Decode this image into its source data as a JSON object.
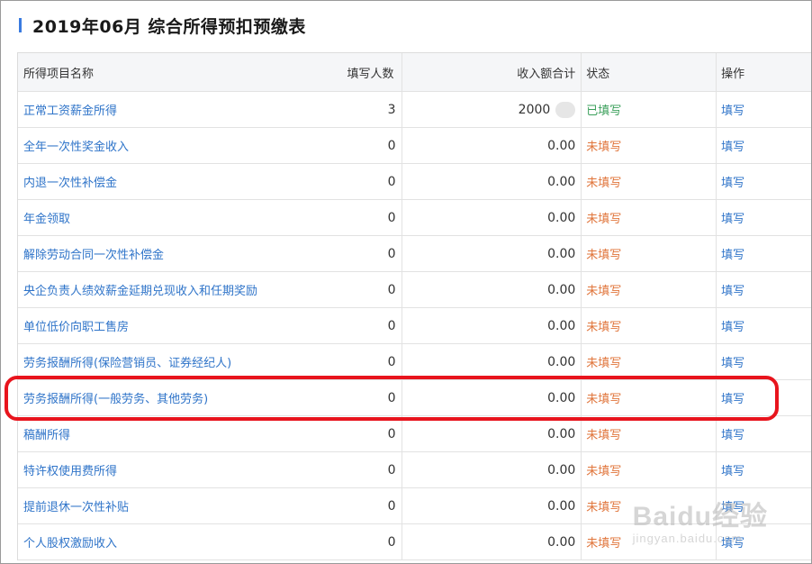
{
  "page": {
    "title": "2019年06月  综合所得预扣预缴表"
  },
  "table": {
    "headers": {
      "name": "所得项目名称",
      "count": "填写人数",
      "amount": "收入额合计",
      "status": "状态",
      "operation": "操作"
    },
    "rows": [
      {
        "name": "正常工资薪金所得",
        "count": "3",
        "amount": "2000",
        "status": "已填写",
        "status_type": "done",
        "op": "填写",
        "amount_blurred": true
      },
      {
        "name": "全年一次性奖金收入",
        "count": "0",
        "amount": "0.00",
        "status": "未填写",
        "status_type": "todo",
        "op": "填写"
      },
      {
        "name": "内退一次性补偿金",
        "count": "0",
        "amount": "0.00",
        "status": "未填写",
        "status_type": "todo",
        "op": "填写"
      },
      {
        "name": "年金领取",
        "count": "0",
        "amount": "0.00",
        "status": "未填写",
        "status_type": "todo",
        "op": "填写"
      },
      {
        "name": "解除劳动合同一次性补偿金",
        "count": "0",
        "amount": "0.00",
        "status": "未填写",
        "status_type": "todo",
        "op": "填写"
      },
      {
        "name": "央企负责人绩效薪金延期兑现收入和任期奖励",
        "count": "0",
        "amount": "0.00",
        "status": "未填写",
        "status_type": "todo",
        "op": "填写"
      },
      {
        "name": "单位低价向职工售房",
        "count": "0",
        "amount": "0.00",
        "status": "未填写",
        "status_type": "todo",
        "op": "填写"
      },
      {
        "name": "劳务报酬所得(保险营销员、证券经纪人)",
        "count": "0",
        "amount": "0.00",
        "status": "未填写",
        "status_type": "todo",
        "op": "填写"
      },
      {
        "name": "劳务报酬所得(一般劳务、其他劳务)",
        "count": "0",
        "amount": "0.00",
        "status": "未填写",
        "status_type": "todo",
        "op": "填写",
        "highlighted": true
      },
      {
        "name": "稿酬所得",
        "count": "0",
        "amount": "0.00",
        "status": "未填写",
        "status_type": "todo",
        "op": "填写"
      },
      {
        "name": "特许权使用费所得",
        "count": "0",
        "amount": "0.00",
        "status": "未填写",
        "status_type": "todo",
        "op": "填写"
      },
      {
        "name": "提前退休一次性补贴",
        "count": "0",
        "amount": "0.00",
        "status": "未填写",
        "status_type": "todo",
        "op": "填写"
      },
      {
        "name": "个人股权激励收入",
        "count": "0",
        "amount": "0.00",
        "status": "未填写",
        "status_type": "todo",
        "op": "填写"
      }
    ]
  },
  "colors": {
    "link": "#2f74c9",
    "status_done": "#3a9f5a",
    "status_todo": "#e0743a",
    "highlight": "#e8141d",
    "accent": "#3a7be0"
  },
  "watermark": {
    "main": "Baidu经验",
    "sub": "jingyan.baidu.com"
  }
}
